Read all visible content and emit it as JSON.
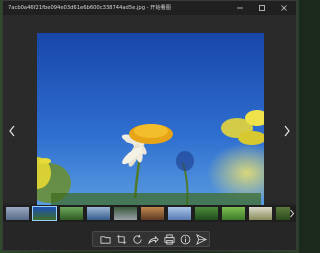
{
  "window": {
    "title": "7acb0a46f21fbe094e03d61e6b600c338744ad5e.jpg - 开始看图",
    "minimize_icon": "minimize-icon",
    "maximize_icon": "maximize-icon",
    "close_icon": "close-icon"
  },
  "viewer": {
    "prev_icon": "chevron-left-icon",
    "next_icon": "chevron-right-icon",
    "filmstrip_next_icon": "chevron-right-icon",
    "thumbnail_count": 11,
    "selected_thumbnail": 1
  },
  "toolbar": {
    "items": [
      "folder-icon",
      "crop-icon",
      "rotate-icon",
      "share-icon",
      "print-icon",
      "info-icon",
      "send-icon"
    ]
  },
  "colors": {
    "background": "#262626",
    "accent": "#9ad1ff"
  }
}
